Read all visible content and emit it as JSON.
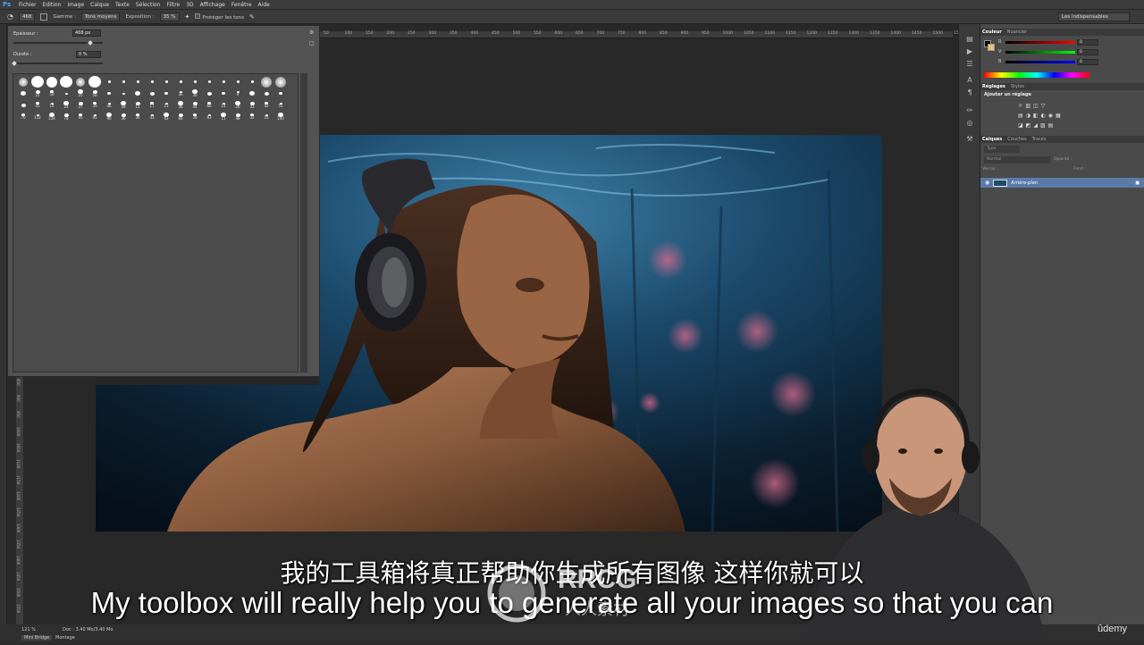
{
  "menu": [
    "Fichier",
    "Edition",
    "Image",
    "Calque",
    "Texte",
    "Sélection",
    "Filtre",
    "3D",
    "Affichage",
    "Fenêtre",
    "Aide"
  ],
  "app_logo": "Ps",
  "options": {
    "brush_size": "468",
    "range_label": "Gamme :",
    "range_value": "Tons moyens",
    "exposure_label": "Exposition :",
    "exposure_value": "35 %",
    "protect_label": "Protéger les tons",
    "workspace_value": "Les indispensables"
  },
  "brush_panel": {
    "size_label": "Epaisseur :",
    "size_value": "468 px",
    "hardness_label": "Dureté :",
    "hardness_value": "0 %",
    "rows": [
      [
        "",
        "",
        "",
        "",
        "",
        "",
        "",
        "",
        "",
        "",
        "",
        "",
        "",
        "",
        "",
        "",
        "",
        "",
        ""
      ],
      [
        "",
        "25",
        "50",
        "",
        "25",
        "50",
        "",
        "",
        "",
        "",
        "",
        "36",
        "30",
        "",
        "",
        "9",
        "",
        "",
        ""
      ],
      [
        "",
        "45",
        "14",
        "24",
        "27",
        "39",
        "46",
        "59",
        "11",
        "17",
        "23",
        "36",
        "44",
        "60",
        "14",
        "26",
        "33",
        "42",
        "55"
      ],
      [
        "70",
        "112",
        "134",
        "74",
        "95",
        "95",
        "90",
        "36",
        "36",
        "33",
        "63",
        "66",
        "39",
        "63",
        "11",
        "48",
        "32",
        "55",
        "100"
      ]
    ]
  },
  "ruler_top": [
    "50",
    "100",
    "150",
    "200",
    "250",
    "300",
    "350",
    "400",
    "450",
    "500",
    "550",
    "600",
    "650",
    "700",
    "750",
    "800",
    "850",
    "900",
    "950",
    "1000",
    "1050",
    "1100",
    "1150",
    "1200",
    "1250",
    "1300",
    "1350",
    "1400",
    "1450",
    "1500",
    "1550"
  ],
  "ruler_left": [
    "850",
    "900",
    "950",
    "1000",
    "1050",
    "1100",
    "1150",
    "1200",
    "1250",
    "1300",
    "1350",
    "1400",
    "1450",
    "1500",
    "1550"
  ],
  "color_panel": {
    "tabs": [
      "Couleur",
      "Nuancier"
    ],
    "channels": [
      {
        "label": "R",
        "value": "0"
      },
      {
        "label": "V",
        "value": "0"
      },
      {
        "label": "B",
        "value": "0"
      }
    ]
  },
  "adjust_panel": {
    "tabs": [
      "Réglages",
      "Styles"
    ],
    "title": "Ajouter un réglage"
  },
  "layers_panel": {
    "tabs": [
      "Calques",
      "Couches",
      "Tracés"
    ],
    "filter": "Type",
    "blend": "Normal",
    "opacity_label": "Opacité :",
    "lock_label": "Verrou :",
    "fill_label": "Fond :",
    "layer_name": "Arrière-plan"
  },
  "status": {
    "zoom": "121 %",
    "doc": "Doc : 3,40 Mo/3,40 Mo",
    "tab_bridge": "Mini Bridge",
    "tab_montage": "Montage"
  },
  "subtitles": {
    "cn": "我的工具箱将真正帮助你生成所有图像 这样你就可以",
    "en": "My toolbox will really help you to generate all your images so that you can"
  },
  "watermark": "RRCG",
  "watermark_sub": "人人素材",
  "brand": "ûdemy",
  "colors": {
    "accent": "#5c7aa8",
    "ui_dark": "#2b2b2b",
    "panel": "#535353"
  }
}
